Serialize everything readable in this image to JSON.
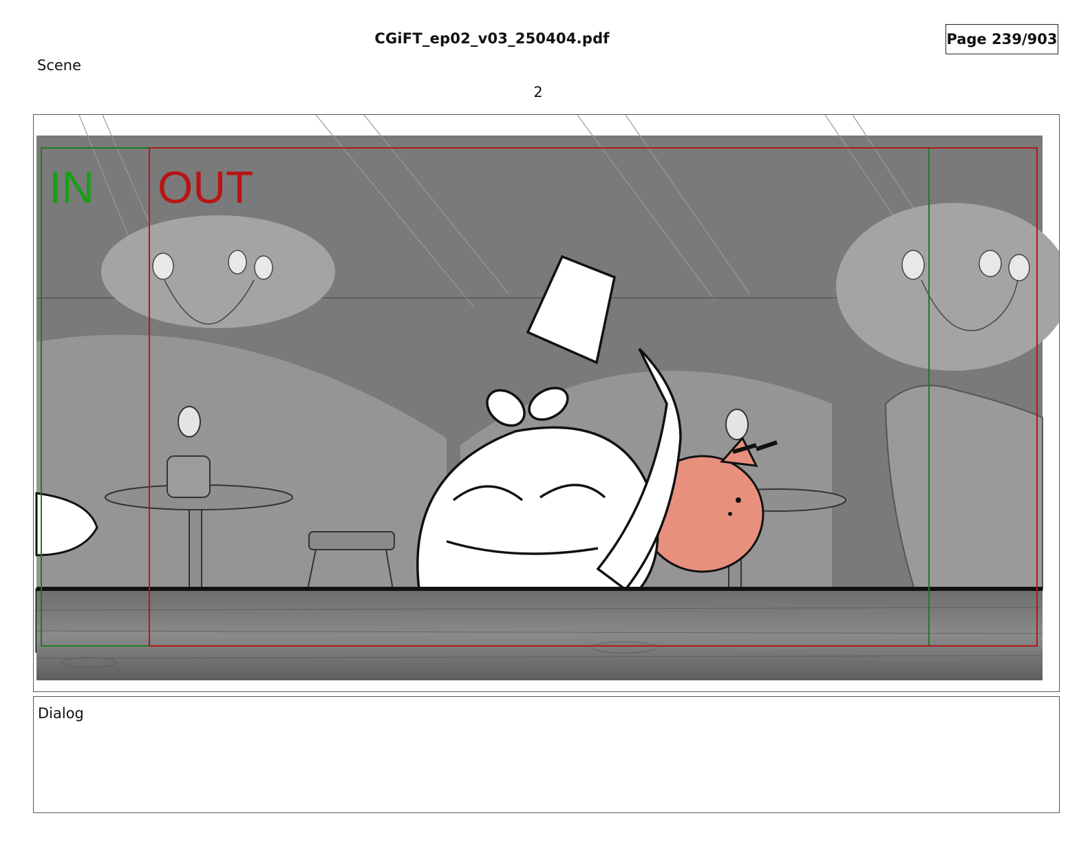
{
  "header": {
    "file_name": "CGiFT_ep02_v03_250404.pdf",
    "page_indicator": "Page 239/903"
  },
  "scene": {
    "label": "Scene",
    "number": "2"
  },
  "panel": {
    "in_label": "IN",
    "out_label": "OUT",
    "in_color": "#1a9e1a",
    "out_color": "#b81414",
    "character_main": "white-bird-character",
    "character_secondary": "pink-pig-character"
  },
  "dialog": {
    "label": "Dialog"
  }
}
